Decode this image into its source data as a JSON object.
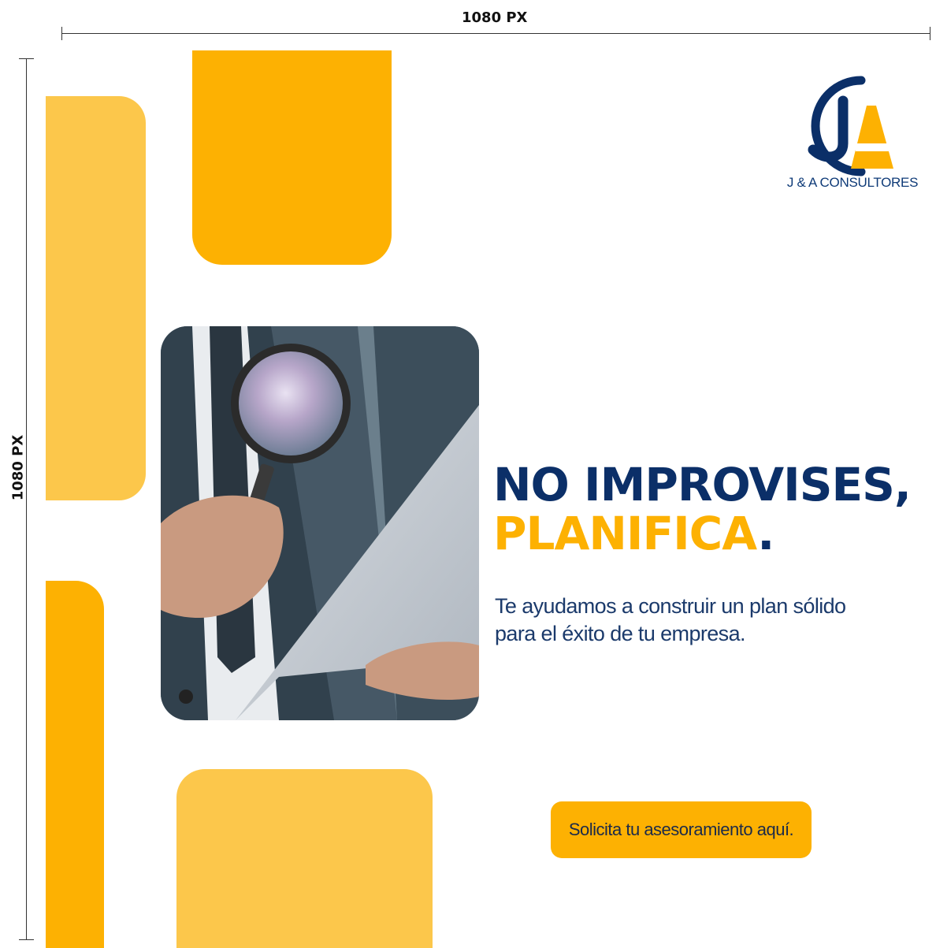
{
  "dimensions": {
    "width_label": "1080 PX",
    "height_label": "1080 PX"
  },
  "brand": {
    "name": "J & A CONSULTORES",
    "logo_letters": "JA",
    "primary_color": "#0b2f68",
    "accent_color": "#fdb102",
    "accent_light": "#fcc74b"
  },
  "headline": {
    "line1": "NO IMPROVISES,",
    "line2": "PLANIFICA",
    "line2_punct": "."
  },
  "subtitle": {
    "line1": "Te ayudamos a construir un plan sólido",
    "line2": "para el éxito de tu empresa."
  },
  "cta": {
    "label": "Solicita tu asesoramiento aquí."
  },
  "photo": {
    "icon": "magnifying-glass-icon"
  }
}
